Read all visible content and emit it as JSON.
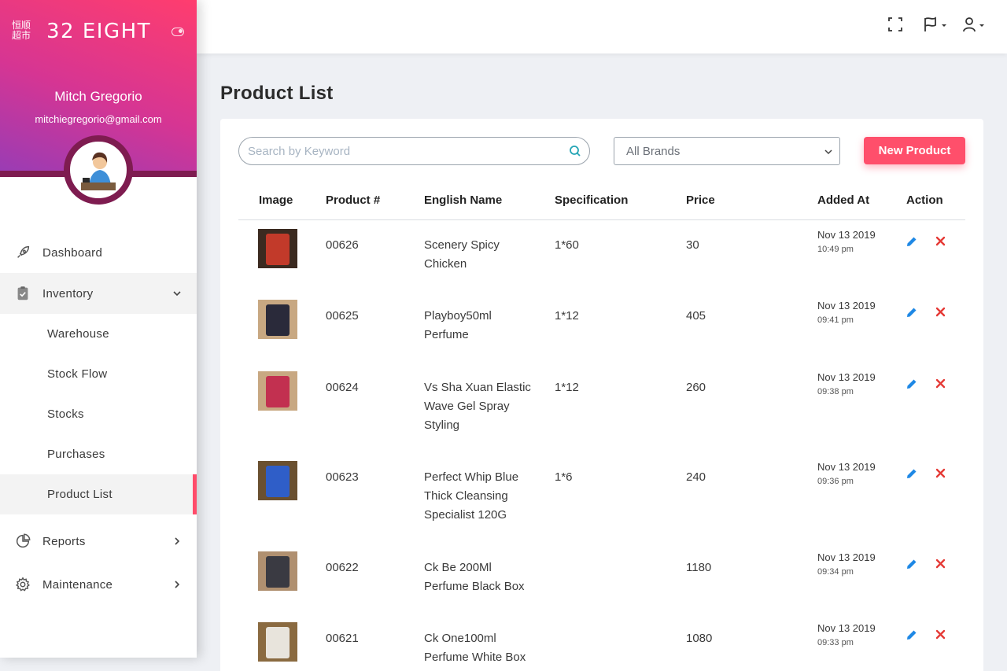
{
  "brand": {
    "logo_text": "恒顺超市",
    "name": "32 EIGHT"
  },
  "user": {
    "name": "Mitch Gregorio",
    "email": "mitchiegregorio@gmail.com"
  },
  "nav": {
    "dashboard": "Dashboard",
    "inventory": "Inventory",
    "inventory_items": [
      "Warehouse",
      "Stock Flow",
      "Stocks",
      "Purchases",
      "Product List"
    ],
    "reports": "Reports",
    "maintenance": "Maintenance"
  },
  "page": {
    "title": "Product List"
  },
  "search": {
    "placeholder": "Search by Keyword",
    "value": ""
  },
  "brand_filter": {
    "selected": "All Brands"
  },
  "new_product_label": "New Product",
  "columns": [
    "Image",
    "Product #",
    "English Name",
    "Specification",
    "Price",
    "Added At",
    "Action"
  ],
  "products": [
    {
      "id": "00626",
      "name": "Scenery Spicy Chicken",
      "spec": "1*60",
      "price": "30",
      "date": "Nov 13 2019",
      "time": "10:49 pm",
      "thumb": [
        "#c23a2a",
        "#3b2a20"
      ]
    },
    {
      "id": "00625",
      "name": "Playboy50ml Perfume",
      "spec": "1*12",
      "price": "405",
      "date": "Nov 13 2019",
      "time": "09:41 pm",
      "thumb": [
        "#2a2a3a",
        "#c8a882"
      ]
    },
    {
      "id": "00624",
      "name": "Vs Sha Xuan Elastic Wave Gel Spray Styling",
      "spec": "1*12",
      "price": "260",
      "date": "Nov 13 2019",
      "time": "09:38 pm",
      "thumb": [
        "#c23050",
        "#c8a882"
      ]
    },
    {
      "id": "00623",
      "name": "Perfect Whip Blue Thick Cleansing Specialist 120G",
      "spec": "1*6",
      "price": "240",
      "date": "Nov 13 2019",
      "time": "09:36 pm",
      "thumb": [
        "#2f5ec8",
        "#6a5030"
      ]
    },
    {
      "id": "00622",
      "name": "Ck Be 200Ml Perfume Black Box",
      "spec": "",
      "price": "1180",
      "date": "Nov 13 2019",
      "time": "09:34 pm",
      "thumb": [
        "#3a3a42",
        "#b09070"
      ]
    },
    {
      "id": "00621",
      "name": "Ck One100ml Perfume White Box",
      "spec": "",
      "price": "1080",
      "date": "Nov 13 2019",
      "time": "09:33 pm",
      "thumb": [
        "#e8e4dc",
        "#8a6a40"
      ]
    }
  ],
  "colors": {
    "accent": "#ff4f6b",
    "edit": "#1e88e5",
    "delete": "#e53935",
    "sidebar_dark": "#7e1c50"
  }
}
